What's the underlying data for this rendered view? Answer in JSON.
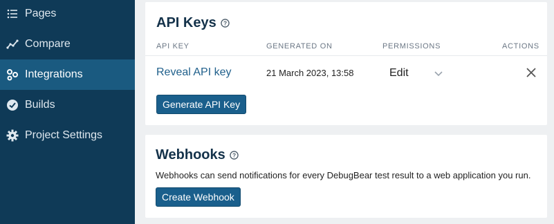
{
  "sidebar": {
    "items": [
      {
        "label": "Pages",
        "icon": "list-icon",
        "active": false
      },
      {
        "label": "Compare",
        "icon": "trend-icon",
        "active": false
      },
      {
        "label": "Integrations",
        "icon": "integrations-icon",
        "active": true
      },
      {
        "label": "Builds",
        "icon": "check-circle-icon",
        "active": false
      },
      {
        "label": "Project Settings",
        "icon": "gear-icon",
        "active": false
      }
    ]
  },
  "api_keys": {
    "title": "API Keys",
    "headers": [
      "API KEY",
      "GENERATED ON",
      "PERMISSIONS",
      "ACTIONS"
    ],
    "row": {
      "key_link": "Reveal API key",
      "generated_on": "21 March 2023, 13:58",
      "permission": "Edit"
    },
    "generate_button": "Generate API Key"
  },
  "webhooks": {
    "title": "Webhooks",
    "description": "Webhooks can send notifications for every DebugBear test result to a web application you run.",
    "create_button": "Create Webhook"
  },
  "colors": {
    "sidebar_bg": "#0f3a57",
    "sidebar_active": "#1a5a80",
    "primary_button": "#1a5f8c",
    "link": "#1f5f8b"
  }
}
